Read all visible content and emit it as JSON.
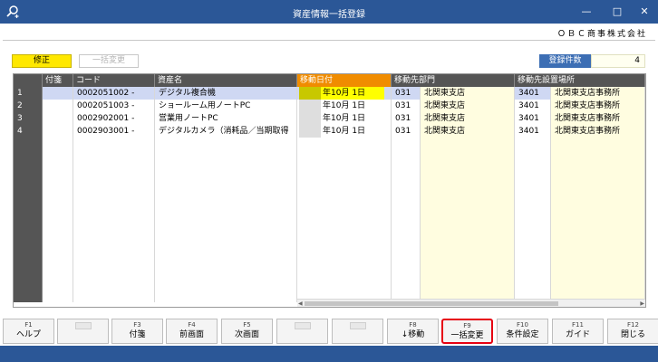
{
  "window": {
    "title": "資産情報一括登録",
    "minimize_glyph": "—",
    "maximize_glyph": "□",
    "close_glyph": "✕",
    "icon": "search-plus-icon"
  },
  "company": "ＯＢＣ商事株式会社",
  "toolbar": {
    "fix_label": "修正",
    "bulk_change_label": "一括変更",
    "count_label": "登録件数",
    "count_value": "4"
  },
  "grid": {
    "columns": [
      "付箋",
      "コード",
      "資産名",
      "移動日付",
      "移動先部門",
      "移動先設置場所"
    ],
    "highlight_color": "#f08c00",
    "rows": [
      {
        "num": "1",
        "code": "0002051002 -",
        "name": "デジタル複合機",
        "date": "年10月  1日",
        "dept_code": "031",
        "dept_name": "北関東支店",
        "loc_code": "3401",
        "loc_name": "北関東支店事務所"
      },
      {
        "num": "2",
        "code": "0002051003 -",
        "name": "ショールーム用ノートPC",
        "date": "年10月  1日",
        "dept_code": "031",
        "dept_name": "北関東支店",
        "loc_code": "3401",
        "loc_name": "北関東支店事務所"
      },
      {
        "num": "3",
        "code": "0002902001 -",
        "name": "営業用ノートPC",
        "date": "年10月  1日",
        "dept_code": "031",
        "dept_name": "北関東支店",
        "loc_code": "3401",
        "loc_name": "北関東支店事務所"
      },
      {
        "num": "4",
        "code": "0002903001 -",
        "name": "デジタルカメラ（消耗品／当期取得",
        "date": "年10月  1日",
        "dept_code": "031",
        "dept_name": "北関東支店",
        "loc_code": "3401",
        "loc_name": "北関東支店事務所"
      }
    ]
  },
  "scrollbar": {
    "left_arrow": "◀",
    "right_arrow": "▶"
  },
  "fkeys": [
    {
      "key": "F1",
      "label": "ヘルプ"
    },
    {
      "key": "",
      "label": ""
    },
    {
      "key": "F3",
      "label": "付箋"
    },
    {
      "key": "F4",
      "label": "前画面"
    },
    {
      "key": "F5",
      "label": "次画面"
    },
    {
      "key": "",
      "label": ""
    },
    {
      "key": "",
      "label": ""
    },
    {
      "key": "F8",
      "label": "↓移動"
    },
    {
      "key": "F9",
      "label": "一括変更"
    },
    {
      "key": "F10",
      "label": "条件設定"
    },
    {
      "key": "F11",
      "label": "ガイド"
    },
    {
      "key": "F12",
      "label": "閉じる"
    }
  ],
  "colors": {
    "titlebar": "#2b5797",
    "fix_button": "#ffe800",
    "selected_outline": "#e60012",
    "input_cell": "#fffde0"
  }
}
